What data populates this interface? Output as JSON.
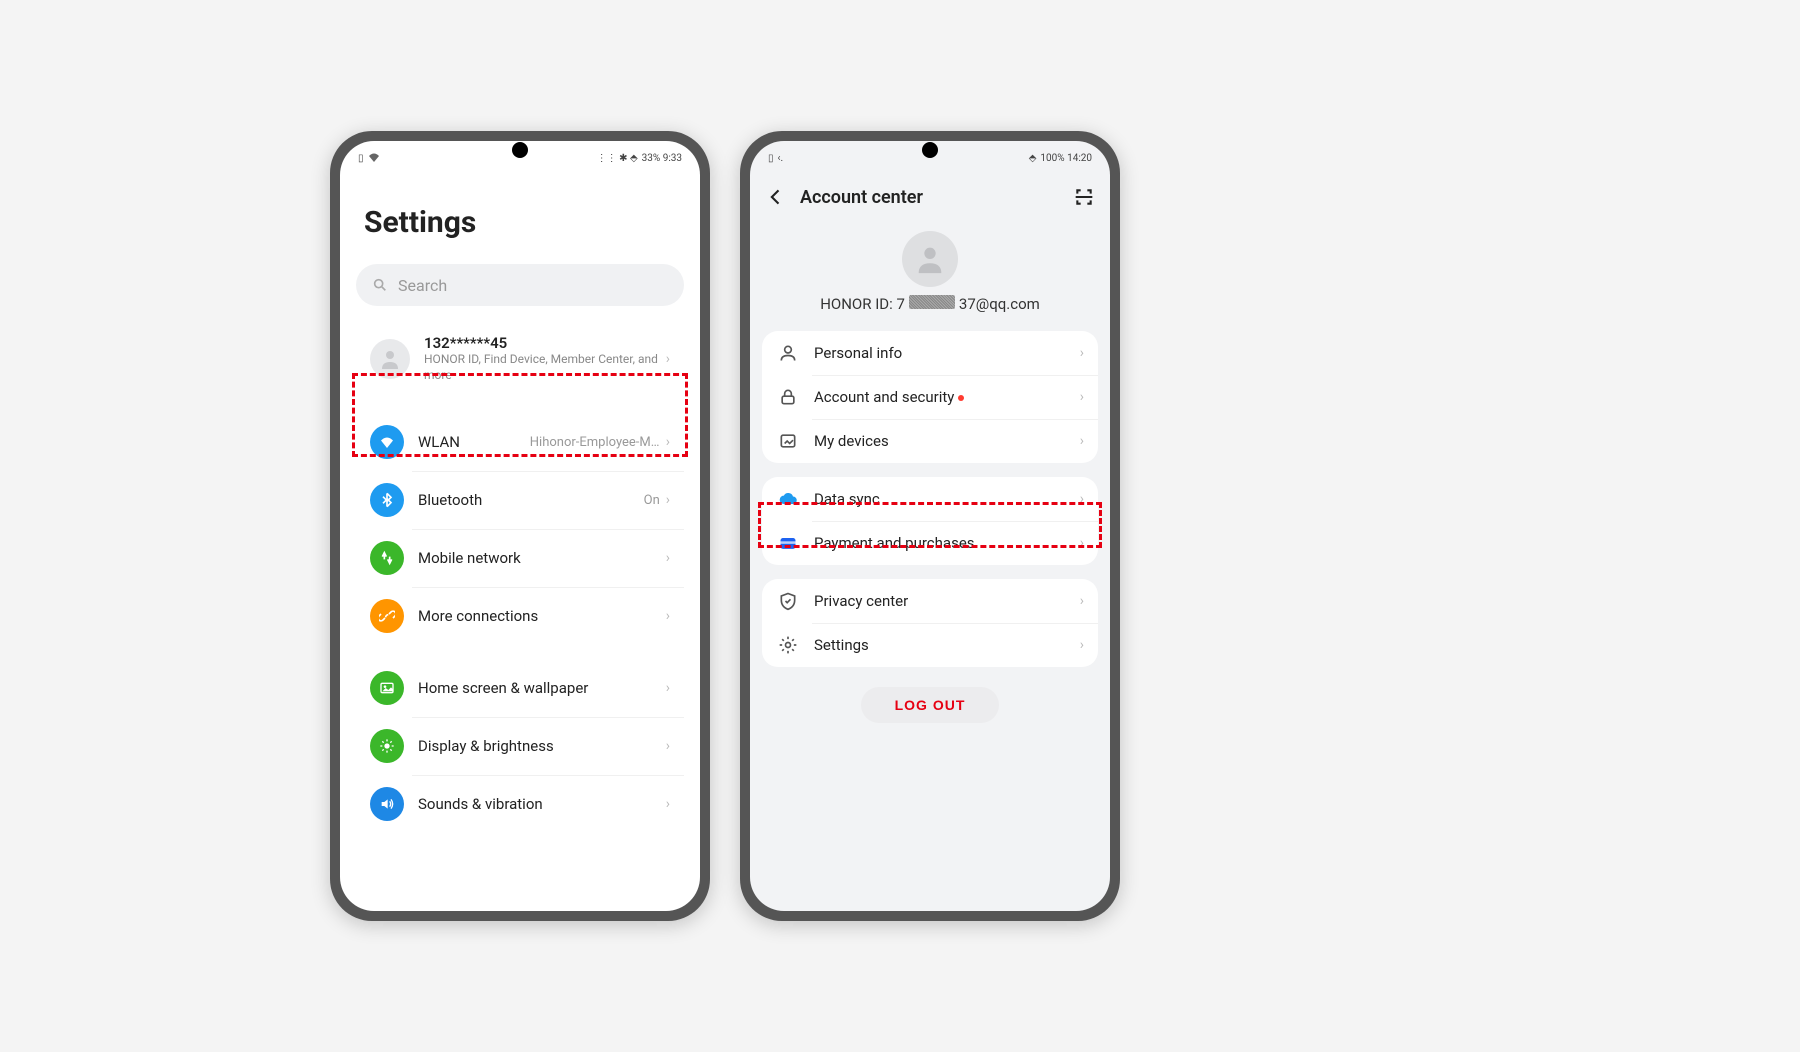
{
  "phone1": {
    "statusbar": {
      "left": "",
      "right": "33% 9:33"
    },
    "title": "Settings",
    "search_placeholder": "Search",
    "account": {
      "name": "132******45",
      "sub": "HONOR ID, Find Device, Member Center, and more"
    },
    "group1": {
      "wlan_label": "WLAN",
      "wlan_value": "Hihonor-Employee-Mobile",
      "bluetooth_label": "Bluetooth",
      "bluetooth_value": "On",
      "mobile_label": "Mobile network",
      "more_label": "More connections"
    },
    "group2": {
      "home_label": "Home screen & wallpaper",
      "display_label": "Display & brightness",
      "sounds_label": "Sounds & vibration"
    }
  },
  "phone2": {
    "statusbar": {
      "left": "",
      "right": "100% 14:20"
    },
    "appbar_title": "Account center",
    "honor_id_prefix": "HONOR ID: 7",
    "honor_id_suffix": "37@qq.com",
    "section1": {
      "personal": "Personal info",
      "security": "Account and security",
      "devices": "My devices"
    },
    "section2": {
      "datasync": "Data sync",
      "payment": "Payment and purchases"
    },
    "section3": {
      "privacy": "Privacy center",
      "settings": "Settings"
    },
    "logout": "LOG OUT"
  }
}
